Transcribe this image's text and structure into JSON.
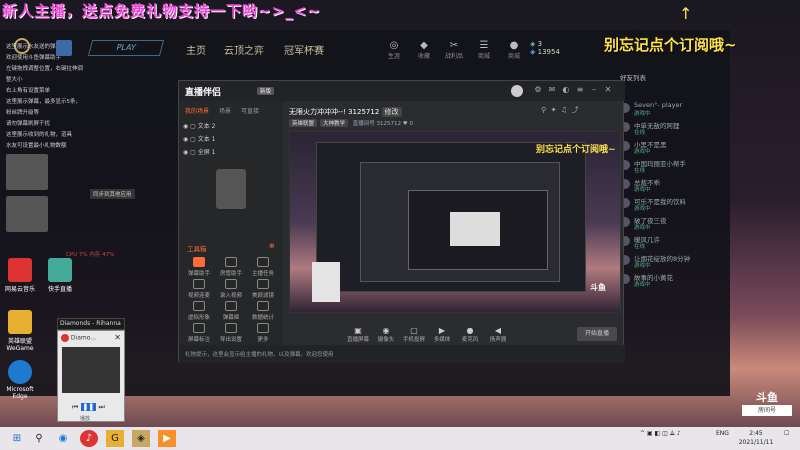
{
  "overlay": {
    "top_banner": "新人主播，送点免费礼物支持一下哟~>_<~",
    "right_banner": "别忘记点个订阅哦~",
    "arrow": "↑",
    "preview_banner": "别忘记点个订阅哦~"
  },
  "game": {
    "play": "PLAY",
    "tabs": [
      "主页",
      "云顶之弈",
      "冠军杯赛"
    ],
    "icons": [
      {
        "glyph": "◎",
        "label": "生涯"
      },
      {
        "glyph": "◆",
        "label": "收藏"
      },
      {
        "glyph": "✂",
        "label": "战利品"
      },
      {
        "glyph": "☰",
        "label": "商城"
      },
      {
        "glyph": "●",
        "label": "商城"
      }
    ],
    "currency_1": "3",
    "currency_2": "13954",
    "friends_header": "好友列表",
    "friends": [
      {
        "name": "Seven°- player",
        "status": "游戏中"
      },
      {
        "name": "中单无敌的阿狸",
        "status": "在线"
      },
      {
        "name": "小黑不是黑",
        "status": "游戏中"
      },
      {
        "name": "中国玛丽亚小帮手",
        "status": "在线"
      },
      {
        "name": "总裁不乖",
        "status": "游戏中"
      },
      {
        "name": "可乐不是我的饮料",
        "status": "游戏中"
      },
      {
        "name": "破了夜三夜",
        "status": "游戏中"
      },
      {
        "name": "暖风几许",
        "status": "在线"
      },
      {
        "name": "让烟花绽放的8分钟",
        "status": "游戏中"
      },
      {
        "name": "故事的小黄花",
        "status": "游戏中"
      }
    ]
  },
  "desktop": {
    "notes": [
      "这里展示水友送的弹幕",
      "欢迎使用斗鱼弹幕助手",
      "左键拖拽调整位置，右键拉伸调整大小",
      "右上角有设置菜单",
      "这里展示弹幕，最多显示5条，粉丝牌升级等",
      "请勿弹幕刷屏干扰",
      "这里展示收到的礼物，道具",
      "水友可设置最小礼物数额"
    ],
    "icons": [
      {
        "label": "网易云音乐",
        "color": "#d33"
      },
      {
        "label": "快手直播",
        "color": "#4a9"
      },
      {
        "label": "英雄联盟WeGame",
        "color": "#e8b030"
      },
      {
        "label": "Microsoft Edge",
        "color": "#1e7ad0"
      }
    ],
    "sysinfo": "CPU 7% 内存 47%",
    "mini_box": "同步到其他应用"
  },
  "music": {
    "title": "Diamonds - Rihanna",
    "mini_title": "Diamo...",
    "pause_label": "播放"
  },
  "app": {
    "logo": "直播伴侣",
    "version": "新版",
    "scene_tabs": [
      "我的场景",
      "场景",
      "可直接"
    ],
    "sources": [
      "文本 2",
      "文本 1",
      "全屏 1"
    ],
    "tools_title": "工具箱",
    "tools": [
      {
        "label": "弹幕助手",
        "on": true
      },
      {
        "label": "房管助手",
        "on": false
      },
      {
        "label": "主播任务",
        "on": false
      },
      {
        "label": "视频连麦",
        "on": false
      },
      {
        "label": "录入视频",
        "on": false
      },
      {
        "label": "美颜滤镜",
        "on": false
      },
      {
        "label": "虚拟形象",
        "on": false
      },
      {
        "label": "弹幕姬",
        "on": false
      },
      {
        "label": "数据统计",
        "on": false
      },
      {
        "label": "屏幕标注",
        "on": false
      },
      {
        "label": "导出设置",
        "on": false
      },
      {
        "label": "更多",
        "on": false
      }
    ],
    "room_title": "无限火力冲冲冲--!",
    "room_id": "3125712",
    "room_edit": "修改",
    "room_category": "英雄联盟",
    "room_tags": "大神教学",
    "room_sub_text": "直播间号 3125712",
    "room_count": "0",
    "bottom_tools": [
      {
        "glyph": "▣",
        "label": "直播屏幕"
      },
      {
        "glyph": "◉",
        "label": "摄像头"
      },
      {
        "glyph": "▢",
        "label": "手机投屏"
      },
      {
        "glyph": "▶",
        "label": "多媒体"
      },
      {
        "glyph": "●",
        "label": "麦克风"
      },
      {
        "glyph": "◀",
        "label": "扬声器"
      }
    ],
    "start_button": "开始直播",
    "status_text": "礼物提示，这里会显示给主播的礼物，以及弹幕。欢迎您使用"
  },
  "watermark": {
    "name": "斗鱼",
    "room": "房间号"
  },
  "taskbar": {
    "apps": [
      "网易云",
      "WeGame",
      "英雄联盟",
      "直播伴侣"
    ],
    "lang": "ENG",
    "time": "2:45",
    "date": "2021/11/11"
  }
}
